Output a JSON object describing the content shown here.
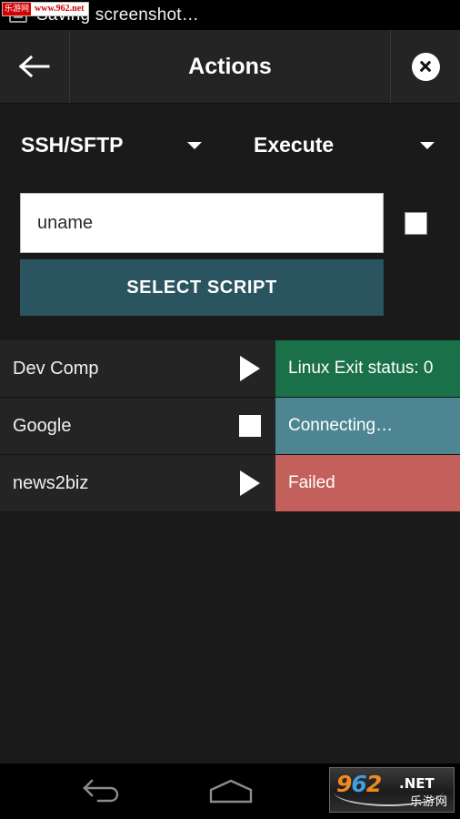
{
  "statusbar": {
    "text": "Saving screenshot…",
    "icon": "screenshot-icon"
  },
  "watermark_top": {
    "badge": "乐游网",
    "url": "www.962.net"
  },
  "actionbar": {
    "back_icon": "arrow-left-icon",
    "title": "Actions",
    "close_icon": "close-circle-icon"
  },
  "selectors": [
    {
      "label": "SSH/SFTP",
      "caret": "chevron-down-icon"
    },
    {
      "label": "Execute",
      "caret": "chevron-down-icon"
    }
  ],
  "command": {
    "value": "uname",
    "placeholder": "uname",
    "checkbox_checked": false
  },
  "select_script": {
    "label": "SELECT SCRIPT",
    "color": "#2a5560"
  },
  "hosts": [
    {
      "name": "Dev Comp",
      "control_icon": "play-icon",
      "status": "Linux Exit status: 0",
      "status_color": "#1a7049"
    },
    {
      "name": "Google",
      "control_icon": "stop-icon",
      "status": "Connecting…",
      "status_color": "#4d8692"
    },
    {
      "name": "news2biz",
      "control_icon": "play-icon",
      "status": "Failed",
      "status_color": "#c4605b"
    }
  ],
  "navbar": {
    "back_icon": "nav-back-icon",
    "home_icon": "nav-home-icon"
  },
  "watermark_bottom": {
    "digit_9": "9",
    "digit_6": "6",
    "digit_2": "2",
    "tld": ".NET",
    "cn": "乐游网"
  }
}
